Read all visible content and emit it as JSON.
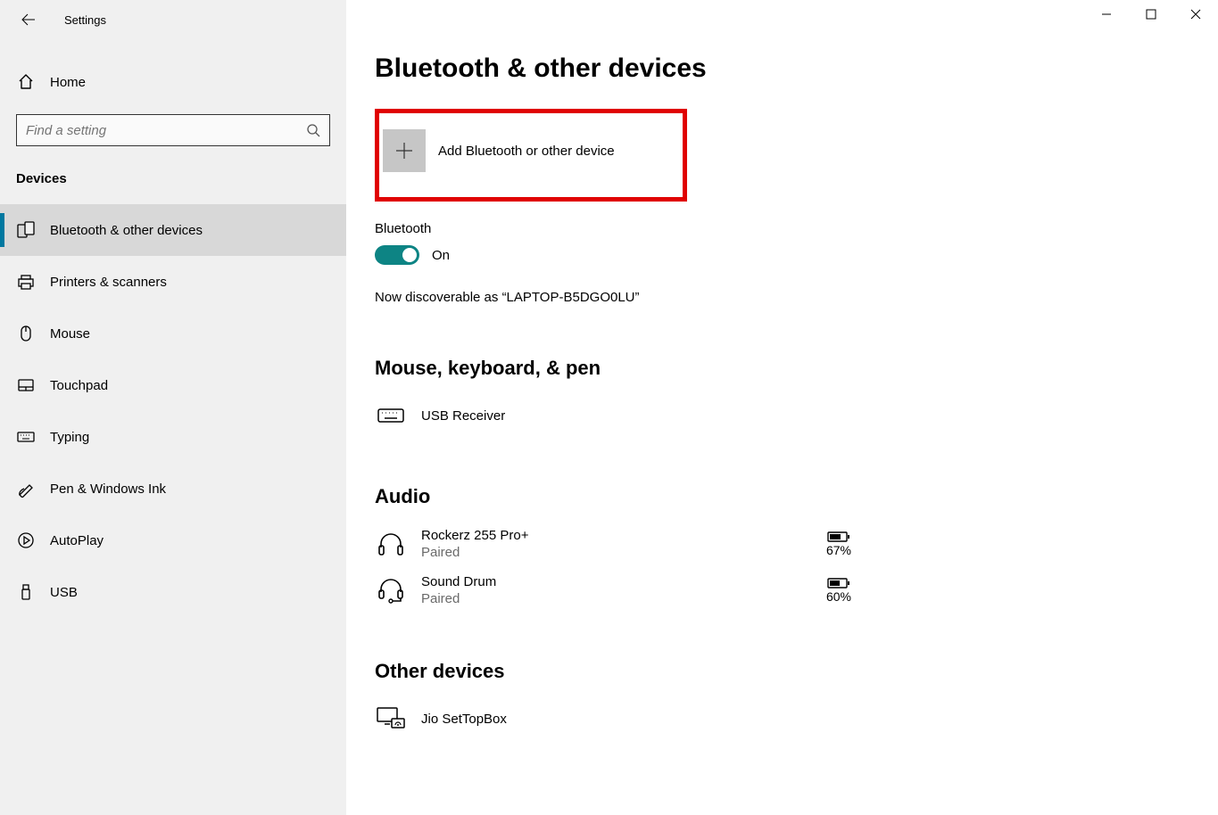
{
  "window": {
    "title": "Settings"
  },
  "sidebar": {
    "home": "Home",
    "search_placeholder": "Find a setting",
    "category": "Devices",
    "items": [
      {
        "label": "Bluetooth & other devices",
        "icon": "bluetooth-devices-icon",
        "selected": true
      },
      {
        "label": "Printers & scanners",
        "icon": "printer-icon"
      },
      {
        "label": "Mouse",
        "icon": "mouse-icon"
      },
      {
        "label": "Touchpad",
        "icon": "touchpad-icon"
      },
      {
        "label": "Typing",
        "icon": "keyboard-icon"
      },
      {
        "label": "Pen & Windows Ink",
        "icon": "pen-icon"
      },
      {
        "label": "AutoPlay",
        "icon": "autoplay-icon"
      },
      {
        "label": "USB",
        "icon": "usb-icon"
      }
    ]
  },
  "main": {
    "page_title": "Bluetooth & other devices",
    "add_device": "Add Bluetooth or other device",
    "bluetooth_label": "Bluetooth",
    "bluetooth_state": "On",
    "discoverable": "Now discoverable as “LAPTOP-B5DGO0LU”",
    "sections": {
      "mkp": {
        "heading": "Mouse, keyboard, & pen",
        "devices": [
          {
            "name": "USB Receiver",
            "status": null,
            "battery": null,
            "icon": "keyboard-icon"
          }
        ]
      },
      "audio": {
        "heading": "Audio",
        "devices": [
          {
            "name": "Rockerz 255 Pro+",
            "status": "Paired",
            "battery": "67%",
            "icon": "headphones-icon"
          },
          {
            "name": "Sound Drum",
            "status": "Paired",
            "battery": "60%",
            "icon": "headset-icon"
          }
        ]
      },
      "other": {
        "heading": "Other devices",
        "devices": [
          {
            "name": "Jio SetTopBox",
            "status": null,
            "battery": null,
            "icon": "settop-icon"
          }
        ]
      }
    }
  }
}
